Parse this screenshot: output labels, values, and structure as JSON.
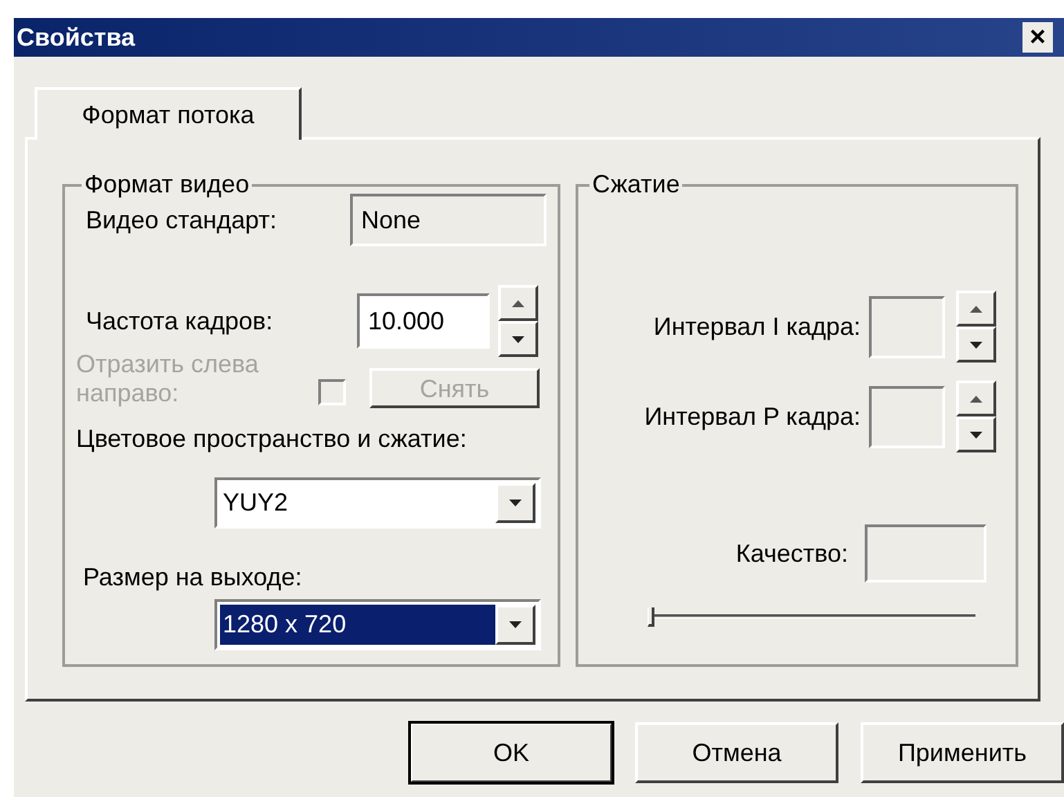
{
  "window": {
    "title": "Свойства",
    "close": "×"
  },
  "tabs": [
    {
      "label": "Формат потока",
      "selected": true
    }
  ],
  "video_format": {
    "title": "Формат видео",
    "video_standard": {
      "label": "Видео стандарт:",
      "value": "None",
      "disabled": true
    },
    "frame_rate": {
      "label": "Частота кадров:",
      "value": "10.000"
    },
    "mirror": {
      "label": "Отразить слева направо:",
      "checked": false,
      "disabled": true,
      "button": "Снять"
    },
    "color_space": {
      "label": "Цветовое пространство и сжатие:",
      "value": "YUY2",
      "selected": false
    },
    "output_size": {
      "label": "Размер на выходе:",
      "value": "1280 x 720",
      "selected": true
    }
  },
  "compression": {
    "title": "Сжатие",
    "i_interval": {
      "label": "Интервал I кадра:",
      "disabled": true
    },
    "p_interval": {
      "label": "Интервал P кадра:",
      "disabled": true
    },
    "quality": {
      "label": "Качество:",
      "disabled": true,
      "level": 0
    }
  },
  "buttons": [
    {
      "label": "OK",
      "default": true
    },
    {
      "label": "Отмена",
      "default": false
    },
    {
      "label": "Применить",
      "default": false
    }
  ]
}
